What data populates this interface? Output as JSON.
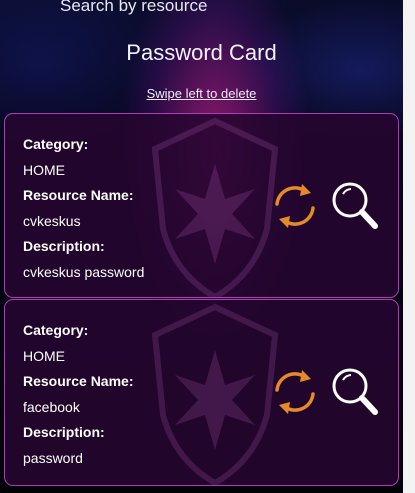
{
  "header": {
    "search_hint": "Search by resource",
    "title": "Password Card",
    "swipe_hint": "Swipe left to delete"
  },
  "cards": [
    {
      "category_label": "Category:",
      "category": "HOME",
      "resource_label": "Resource Name:",
      "resource": "cvkeskus",
      "description_label": "Description:",
      "description": "cvkeskus password"
    },
    {
      "category_label": "Category:",
      "category": "HOME",
      "resource_label": "Resource Name:",
      "resource": "facebook",
      "description_label": "Description:",
      "description": "password"
    }
  ],
  "colors": {
    "accent_orange": "#e58a2a",
    "card_border": "#b23ab4"
  },
  "icons": [
    "refresh-icon",
    "magnifier-icon",
    "shield-emblem-icon"
  ]
}
